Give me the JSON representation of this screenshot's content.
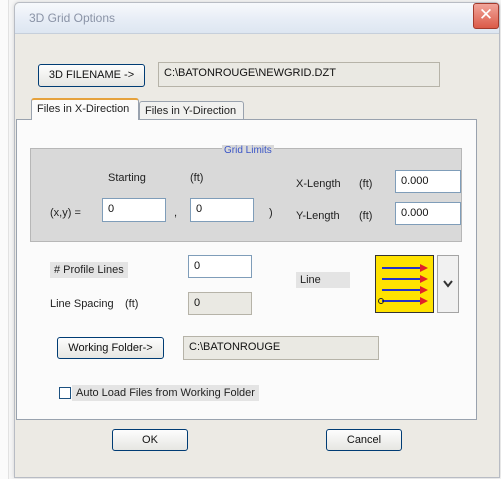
{
  "dialog": {
    "title": "3D Grid Options",
    "close_glyph": "✕"
  },
  "file": {
    "button_label": "3D FILENAME ->",
    "path": "C:\\BATONROUGE\\NEWGRID.DZT"
  },
  "tabs": [
    {
      "label": "Files in X-Direction",
      "active": true
    },
    {
      "label": "Files in Y-Direction",
      "active": false
    }
  ],
  "grid_limits": {
    "title": "Grid Limits",
    "starting_label": "Starting",
    "unit": "(ft)",
    "xy_label": "(x,y) =",
    "x_value": "0",
    "comma": ",",
    "y_value": "0",
    "close_paren": ")",
    "x_length_label": "X-Length",
    "x_length_value": "0.000",
    "y_length_label": "Y-Length",
    "y_length_value": "0.000"
  },
  "profile": {
    "lines_label": "# Profile Lines",
    "lines_value": "0",
    "spacing_label": "Line Spacing",
    "spacing_unit": "(ft)",
    "spacing_value": "0",
    "line_label": "Line"
  },
  "working_folder": {
    "button_label": "Working Folder->",
    "path": "C:\\BATONROUGE"
  },
  "auto_load": {
    "label": "Auto Load Files from Working Folder",
    "checked": false
  },
  "buttons": {
    "ok": "OK",
    "cancel": "Cancel"
  },
  "icons": {
    "close": "close-icon",
    "chevron": "chevron-down-icon",
    "line_preview": "line-direction-icon"
  },
  "colors": {
    "line_preview_bg": "#ffe200",
    "arrow_color": "#e0202a",
    "line_color": "#2432c8",
    "group_title": "#3a55c6",
    "active_tab_accent": "#e6a23c"
  }
}
